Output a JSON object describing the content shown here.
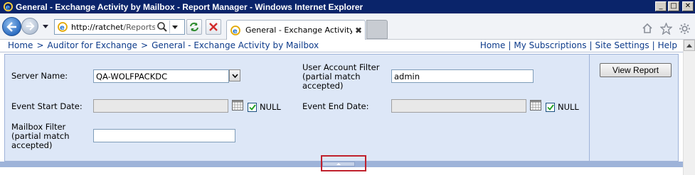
{
  "window": {
    "title": "General - Exchange Activity by Mailbox - Report Manager - Windows Internet Explorer",
    "controls": {
      "minimize": "_",
      "maximize": "□",
      "close": "✕"
    }
  },
  "browser": {
    "url_host": "http://ratchet",
    "url_path": "/Reports/P...",
    "tab_label": "General - Exchange Activity ...",
    "tab_close": "✖"
  },
  "breadcrumb": {
    "items": [
      "Home",
      "Auditor for Exchange",
      "General - Exchange Activity by Mailbox"
    ],
    "separator": ">"
  },
  "top_links": [
    "Home",
    "My Subscriptions",
    "Site Settings",
    "Help"
  ],
  "top_links_separator": "|",
  "params": {
    "server_name_label": "Server Name:",
    "server_name_value": "QA-WOLFPACKDC",
    "user_filter_label_1": "User Account Filter",
    "user_filter_label_2": "(partial match",
    "user_filter_label_3": "accepted)",
    "user_filter_value": "admin",
    "event_start_label": "Event Start Date:",
    "event_start_value": "",
    "event_start_null": "NULL",
    "event_end_label": "Event End Date:",
    "event_end_value": "",
    "event_end_null": "NULL",
    "mailbox_filter_label_1": "Mailbox Filter",
    "mailbox_filter_label_2": "(partial match",
    "mailbox_filter_label_3": "accepted)",
    "mailbox_filter_value": ""
  },
  "view_report_label": "View Report",
  "colors": {
    "titlebar": "#0a246a",
    "param_bg": "#dde7f7",
    "link": "#0c3a8a",
    "highlight": "#c0202c"
  },
  "icons": [
    "ie-logo-icon",
    "back-arrow-icon",
    "forward-arrow-icon",
    "page-icon",
    "search-icon",
    "refresh-icon",
    "stop-icon",
    "home-icon",
    "favorites-star-icon",
    "tools-gear-icon",
    "calendar-icon",
    "checkmark-icon",
    "collapse-arrow-icon"
  ]
}
